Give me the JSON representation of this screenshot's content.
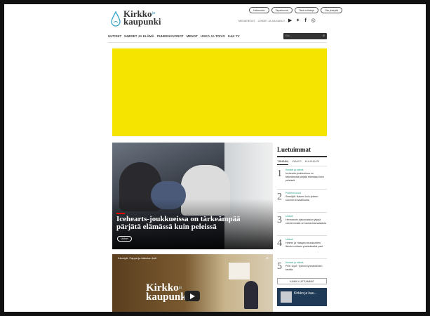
{
  "header": {
    "logo_line1": "Kirkko",
    "logo_sup": "ja",
    "logo_line2": "kaupunki",
    "pills": [
      "Hakemisto",
      "Tapahtumat",
      "Tilaa uutiskirje",
      "Ota yhteyttä"
    ],
    "subtop_links": [
      "MEDIATIEDOT",
      "LEHDET JA JULKAISUT"
    ],
    "social_icons": [
      "youtube-icon",
      "twitter-icon",
      "facebook-icon",
      "instagram-icon"
    ]
  },
  "nav": {
    "items": [
      "UUTISET",
      "IHMISET JA ELÄMÄ",
      "PUHEENVUOROT",
      "MENOT",
      "USKO JA TOIVO",
      "K&K TV"
    ],
    "search_placeholder": "Etsi..."
  },
  "ad": {
    "color": "#f5e400"
  },
  "hero": {
    "title": "Icehearts-joukkueissa on tärkeämpää pärjätä elämässä kuin peleissä",
    "tag": "Uutiset",
    "accent": "#e00000"
  },
  "video": {
    "title": "Kävelytt. Pappa ja Aakolan koti",
    "logo_line1": "Kirkko",
    "logo_sup": "ja",
    "logo_line2": "kaupunki"
  },
  "sidebar": {
    "title": "Luetuimmat",
    "tabs": [
      "TÄNÄÄN",
      "VIIKKO",
      "KUUKAUSI"
    ],
    "active_tab": "TÄNÄÄN",
    "items": [
      {
        "num": "1",
        "category": "Ihmiset ja elämä",
        "text": "Icehearts-joukkueissa on tärkeämpää pärjätä elämässä kuin peleissä"
      },
      {
        "num": "2",
        "category": "Puheenvuorot",
        "text": "Svenijää: Nainen kulu yhteen suomen kovaalliuutta"
      },
      {
        "num": "3",
        "category": "Uutiset",
        "text": "Hermannin diakoniatalon ylippä vanhemmistä on kantaviesmaalaista"
      },
      {
        "num": "4",
        "category": "Uutiset",
        "text": "Helmin ja Haagan seurakuntien liitosta voidaan yhteinäkaikki parit"
      },
      {
        "num": "5",
        "category": "Ihmiset ja elämä",
        "text": "Peer Gynt: Työrmä lyhtnäoteiden tasalla"
      }
    ],
    "more_button": "KAIKKI LUETUIMMAT",
    "mini_title": "Kirkko ja kau..."
  },
  "colors": {
    "teal_category": "#2a9d8f",
    "dark": "#222222"
  }
}
